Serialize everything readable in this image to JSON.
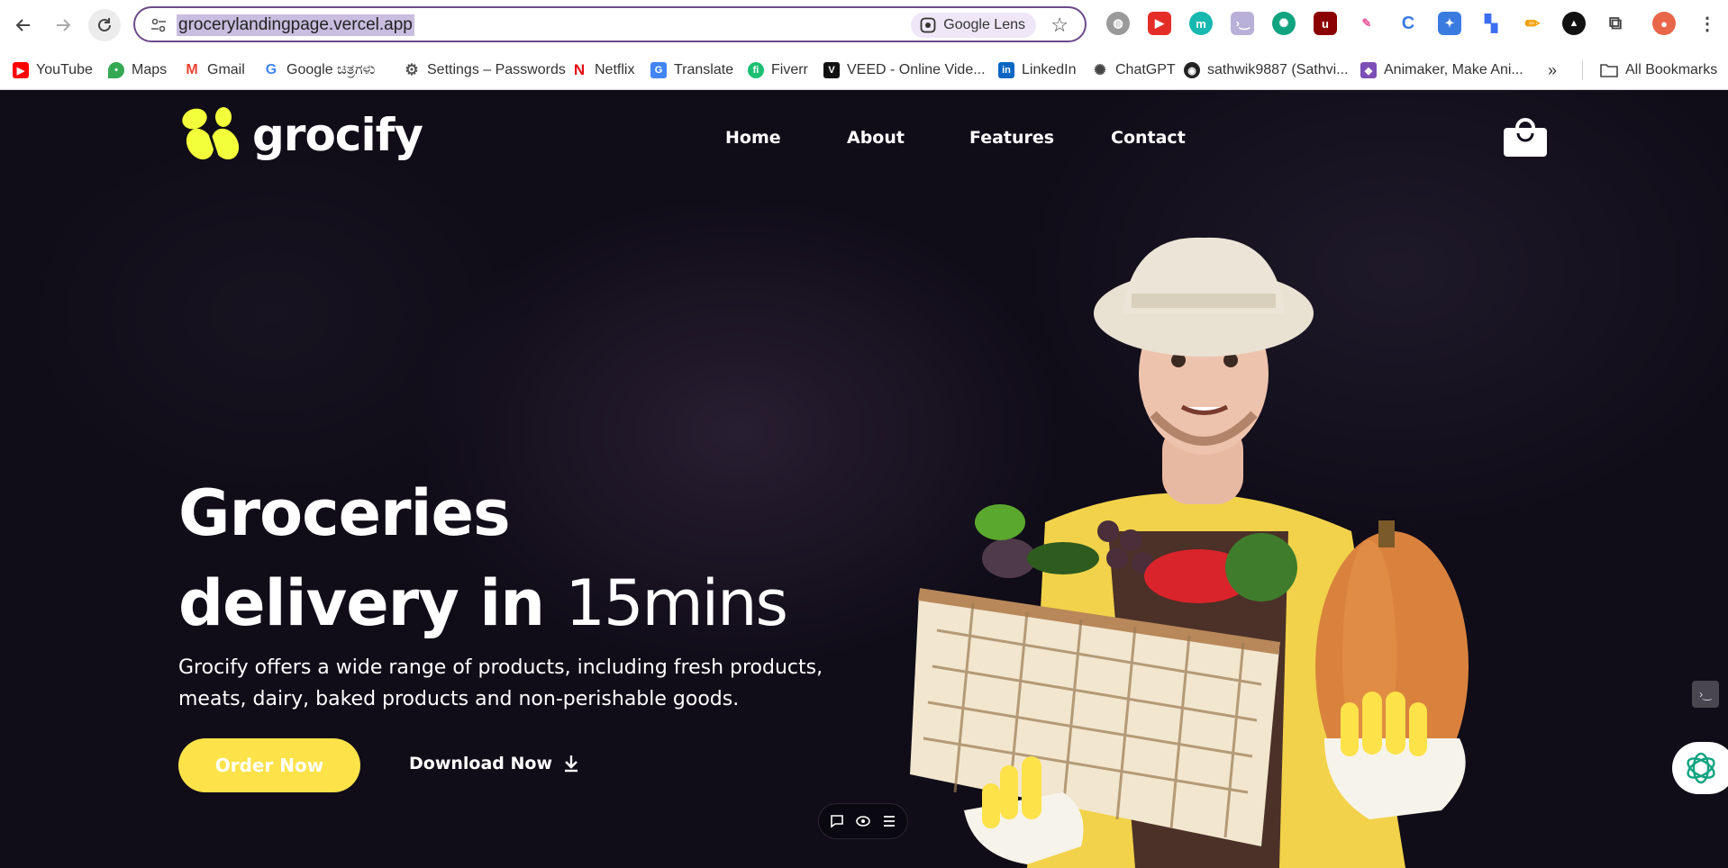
{
  "browser": {
    "url": "grocerylandingpage.vercel.app",
    "lens_label": "Google Lens",
    "bookmarks": [
      {
        "label": "YouTube",
        "icon": "youtube-icon",
        "color": "#ff0000"
      },
      {
        "label": "Maps",
        "icon": "maps-icon",
        "color": "#34a853"
      },
      {
        "label": "Gmail",
        "icon": "gmail-icon",
        "color": "#ea4335"
      },
      {
        "label": "Google ಚಿತ್ರಗಳು",
        "icon": "google-icon",
        "color": "#4285f4"
      },
      {
        "label": "Settings – Passwords",
        "icon": "gear-icon",
        "color": "#555555"
      },
      {
        "label": "Netflix",
        "icon": "netflix-icon",
        "color": "#e50914"
      },
      {
        "label": "Translate",
        "icon": "translate-icon",
        "color": "#4285f4"
      },
      {
        "label": "Fiverr",
        "icon": "fiverr-icon",
        "color": "#1dbf73"
      },
      {
        "label": "VEED - Online Vide...",
        "icon": "veed-icon",
        "color": "#111111"
      },
      {
        "label": "LinkedIn",
        "icon": "linkedin-icon",
        "color": "#0a66c2"
      },
      {
        "label": "ChatGPT",
        "icon": "chatgpt-icon",
        "color": "#444444"
      },
      {
        "label": "sathwik9887 (Sathvi...",
        "icon": "github-icon",
        "color": "#222222"
      },
      {
        "label": "Animaker, Make Ani...",
        "icon": "animaker-icon",
        "color": "#7b4fb5"
      }
    ],
    "all_bookmarks": "All Bookmarks",
    "overflow": "»"
  },
  "site": {
    "logo": "grocify",
    "nav": [
      "Home",
      "About",
      "Features",
      "Contact"
    ],
    "hero_line1": "Groceries",
    "hero_line2_bold": "delivery in",
    "hero_line2_thin": "15mins",
    "description": "Grocify offers a wide range of products, including fresh products, meats, dairy, baked products and non-perishable goods.",
    "order_button": "Order Now",
    "download_button": "Download Now",
    "accent_color": "#fde249"
  }
}
